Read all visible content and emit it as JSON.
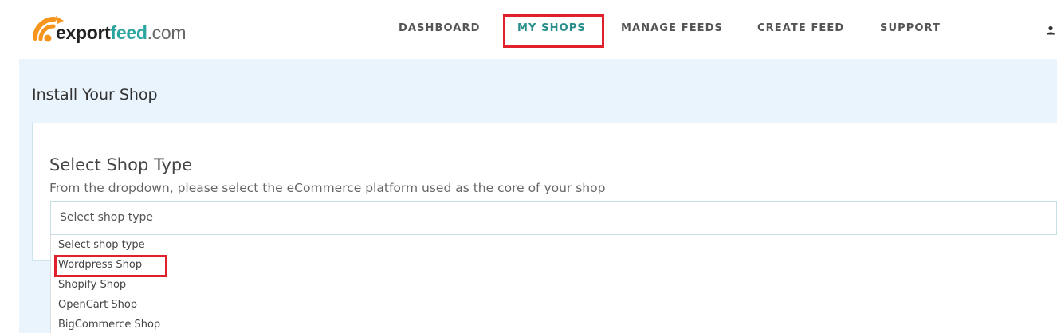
{
  "brand": {
    "part1": "export",
    "part2": "feed",
    "part3": ".com",
    "accent_orange": "#f7941d",
    "accent_teal": "#2aa5a0"
  },
  "nav": {
    "items": [
      {
        "label": "DASHBOARD"
      },
      {
        "label": "MY SHOPS",
        "active": true
      },
      {
        "label": "MANAGE FEEDS"
      },
      {
        "label": "CREATE FEED"
      },
      {
        "label": "SUPPORT"
      }
    ],
    "user_icon": "user-icon"
  },
  "page": {
    "title": "Install Your Shop"
  },
  "card": {
    "title": "Select Shop Type",
    "description": "From the dropdown, please select the eCommerce platform used as the core of your shop"
  },
  "shop_select": {
    "selected": "Select shop type",
    "options": [
      "Select shop type",
      "Wordpress Shop",
      "Shopify Shop",
      "OpenCart Shop",
      "BigCommerce Shop"
    ]
  },
  "highlight_color": "#e0202a"
}
